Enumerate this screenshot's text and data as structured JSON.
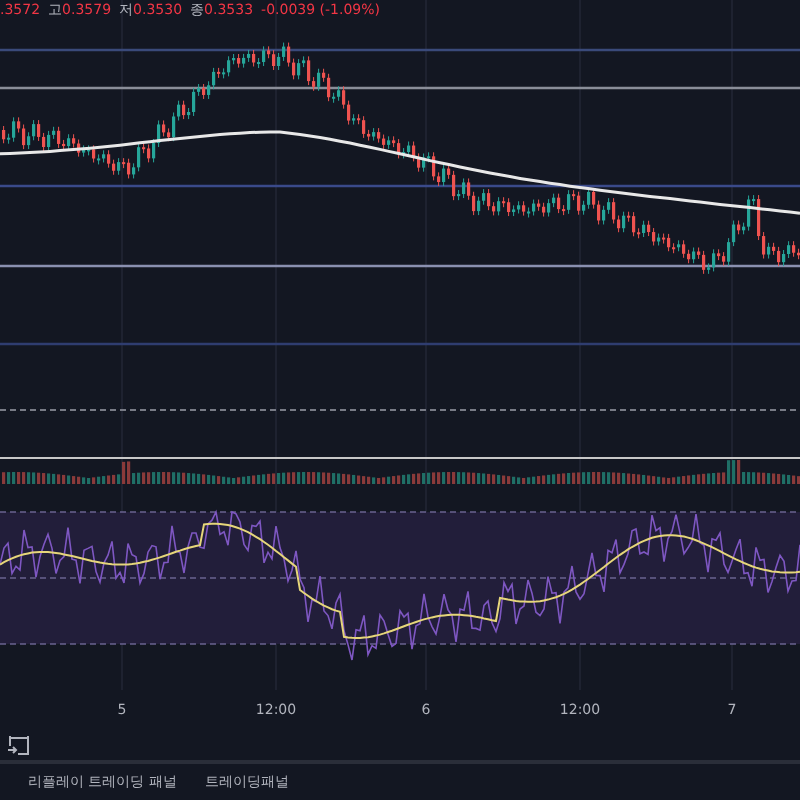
{
  "legend": {
    "open": ".3572",
    "items": [
      {
        "label": "고",
        "value": "0.3579"
      },
      {
        "label": "저",
        "value": "0.3530"
      },
      {
        "label": "종",
        "value": "0.3533"
      }
    ],
    "change": "-0.0039 (-1.09%)"
  },
  "time_axis": [
    "5",
    "12:00",
    "6",
    "12:00",
    "7"
  ],
  "bottom_tabs": [
    {
      "label": "리플레이 트레이딩 패널",
      "selected": false
    },
    {
      "label": "트레이딩패널",
      "selected": false
    }
  ]
}
